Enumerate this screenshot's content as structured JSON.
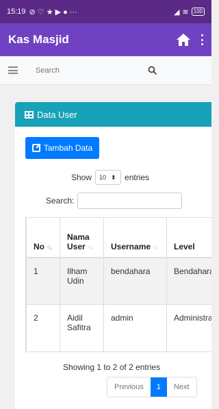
{
  "status_bar": {
    "time": "15:19",
    "icons_text": "⊘ ♡ ★ ▶ ● ···",
    "battery": "100"
  },
  "app": {
    "title": "Kas Masjid"
  },
  "search": {
    "placeholder": "Search"
  },
  "card": {
    "title": "Data User",
    "add_button": "Tambah Data",
    "show_label": "Show",
    "entries_value": "10",
    "entries_label": "entries",
    "search_label": "Search:"
  },
  "table": {
    "headers": {
      "no": "No",
      "nama_line1": "Nama",
      "nama_line2": "User",
      "username": "Username",
      "level": "Level"
    },
    "rows": [
      {
        "no": "1",
        "nama_line1": "Ilham",
        "nama_line2": "Udin",
        "username": "bendahara",
        "level": "Bendahara"
      },
      {
        "no": "2",
        "nama_line1": "Aidil",
        "nama_line2": "Safitra",
        "username": "admin",
        "level": "Administrator"
      }
    ]
  },
  "info": "Showing 1 to 2 of 2 entries",
  "pagination": {
    "previous": "Previous",
    "current": "1",
    "next": "Next"
  }
}
